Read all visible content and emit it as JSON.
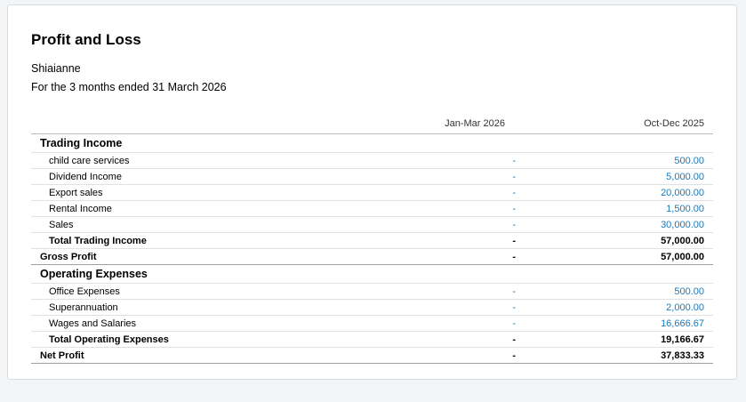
{
  "report": {
    "title": "Profit and Loss",
    "organisation": "Shiaianne",
    "period": "For the 3 months ended 31 March 2026",
    "columns": [
      "Jan-Mar 2026",
      "Oct-Dec 2025"
    ]
  },
  "trading_income": {
    "heading": "Trading Income",
    "items": [
      {
        "label": "child care services",
        "a": "-",
        "b": "500.00"
      },
      {
        "label": "Dividend Income",
        "a": "-",
        "b": "5,000.00"
      },
      {
        "label": "Export sales",
        "a": "-",
        "b": "20,000.00"
      },
      {
        "label": "Rental Income",
        "a": "-",
        "b": "1,500.00"
      },
      {
        "label": "Sales",
        "a": "-",
        "b": "30,000.00"
      }
    ],
    "total": {
      "label": "Total Trading Income",
      "a": "-",
      "b": "57,000.00"
    }
  },
  "gross_profit": {
    "label": "Gross Profit",
    "a": "-",
    "b": "57,000.00"
  },
  "operating_expenses": {
    "heading": "Operating Expenses",
    "items": [
      {
        "label": "Office Expenses",
        "a": "-",
        "b": "500.00"
      },
      {
        "label": "Superannuation",
        "a": "-",
        "b": "2,000.00"
      },
      {
        "label": "Wages and Salaries",
        "a": "-",
        "b": "16,666.67"
      }
    ],
    "total": {
      "label": "Total Operating Expenses",
      "a": "-",
      "b": "19,166.67"
    }
  },
  "net_profit": {
    "label": "Net Profit",
    "a": "-",
    "b": "37,833.33"
  },
  "colors": {
    "link": "#1a7ab8",
    "page_bg": "#f4f5f6"
  }
}
